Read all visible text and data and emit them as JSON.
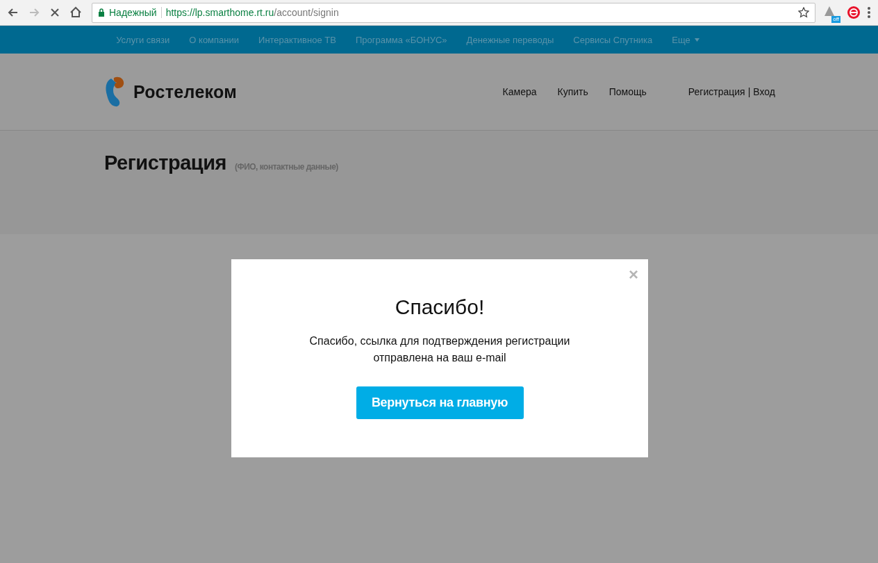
{
  "browser": {
    "secure_label": "Надежный",
    "url_host": "https://lp.smarthome.rt.ru",
    "url_path": "/account/signin",
    "extension_badge": "off"
  },
  "top_nav": {
    "items": [
      "Услуги связи",
      "О компании",
      "Интерактивное ТВ",
      "Программа «БОНУС»",
      "Денежные переводы",
      "Сервисы Спутника"
    ],
    "more": "Еще"
  },
  "header": {
    "logo_text": "Ростелеком",
    "links": [
      "Камера",
      "Купить",
      "Помощь"
    ],
    "auth": {
      "register": "Регистрация",
      "separator": "|",
      "login": "Вход"
    }
  },
  "page": {
    "title": "Регистрация",
    "subtitle": "(ФИО, контактные данные)"
  },
  "modal": {
    "close": "×",
    "title": "Спасибо!",
    "message_lines": [
      "Спасибо, ссылка для подтверждения регистрации",
      "отправлена на ваш e-mail"
    ],
    "button": "Вернуться на главную"
  }
}
